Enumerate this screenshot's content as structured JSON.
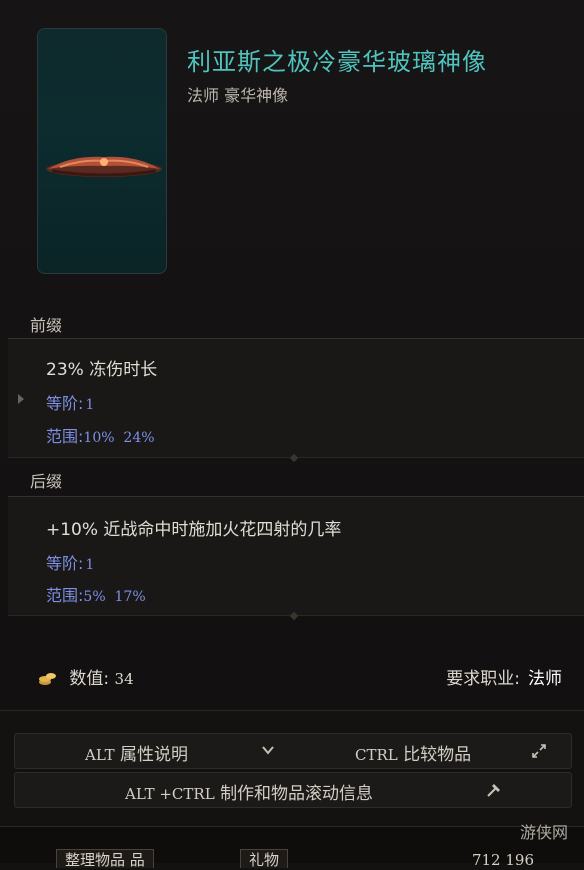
{
  "item": {
    "title": "利亚斯之极冷豪华玻璃神像",
    "subtitle": "法师 豪华神像"
  },
  "prefix": {
    "heading": "前缀",
    "affix": "23% 冻伤时长",
    "tier_label": "等阶:",
    "tier_value": "1",
    "range_label": "范围:",
    "range_values": "10%  24%"
  },
  "suffix": {
    "heading": "后缀",
    "affix": "+10% 近战命中时施加火花四射的几率",
    "tier_label": "等阶:",
    "tier_value": "1",
    "range_label": "范围:",
    "range_values": "5%  17%"
  },
  "value": {
    "label": "数值:",
    "amount": "34"
  },
  "requirement": {
    "label": "要求职业:",
    "class": "法师"
  },
  "buttons": {
    "alt_key": "ALT",
    "alt_label": "属性说明",
    "ctrl_key": "CTRL",
    "ctrl_label": "比较物品",
    "altctrl_key": "ALT +CTRL",
    "altctrl_label": "制作和物品滚动信息"
  },
  "bottom": {
    "tab1": "整理物品 品",
    "tab2": "礼物",
    "gold": "712 196"
  },
  "watermark": "游侠网",
  "colors": {
    "title": "#4fc4be",
    "tier": "#7d8fe6"
  }
}
